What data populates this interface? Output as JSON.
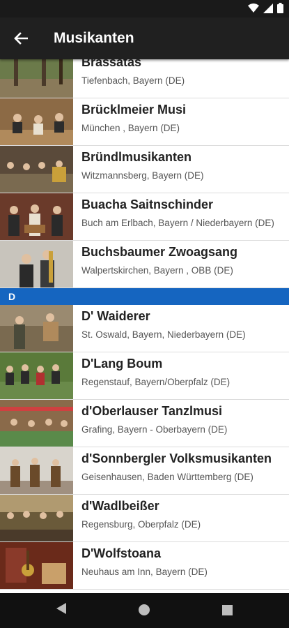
{
  "appbar": {
    "title": "Musikanten"
  },
  "section": {
    "label": "D"
  },
  "bands_b": [
    {
      "name": "Brassatas",
      "location": "Tiefenbach, Bayern (DE)"
    },
    {
      "name": "Brücklmeier Musi",
      "location": "München , Bayern (DE)"
    },
    {
      "name": "Bründlmusikanten",
      "location": "Witzmannsberg, Bayern (DE)"
    },
    {
      "name": "Buacha Saitnschinder",
      "location": "Buch am Erlbach, Bayern / Niederbayern (DE)"
    },
    {
      "name": "Buchsbaumer Zwoagsang",
      "location": "Walpertskirchen, Bayern , OBB (DE)"
    }
  ],
  "bands_d": [
    {
      "name": "D' Waiderer",
      "location": "St. Oswald, Bayern, Niederbayern (DE)"
    },
    {
      "name": "D'Lang Boum",
      "location": "Regenstauf, Bayern/Oberpfalz (DE)"
    },
    {
      "name": "d'Oberlauser Tanzlmusi",
      "location": "Grafing, Bayern - Oberbayern (DE)"
    },
    {
      "name": "d'Sonnbergler Volksmusikanten",
      "location": "Geisenhausen, Baden Württemberg (DE)"
    },
    {
      "name": "d'Wadlbeißer",
      "location": "Regensburg, Oberpfalz (DE)"
    },
    {
      "name": "D'Wolfstoana",
      "location": "Neuhaus am Inn, Bayern (DE)"
    }
  ],
  "icons": {
    "back": "arrow-left-icon",
    "wifi": "wifi-icon",
    "signal": "signal-icon",
    "battery": "battery-icon"
  }
}
